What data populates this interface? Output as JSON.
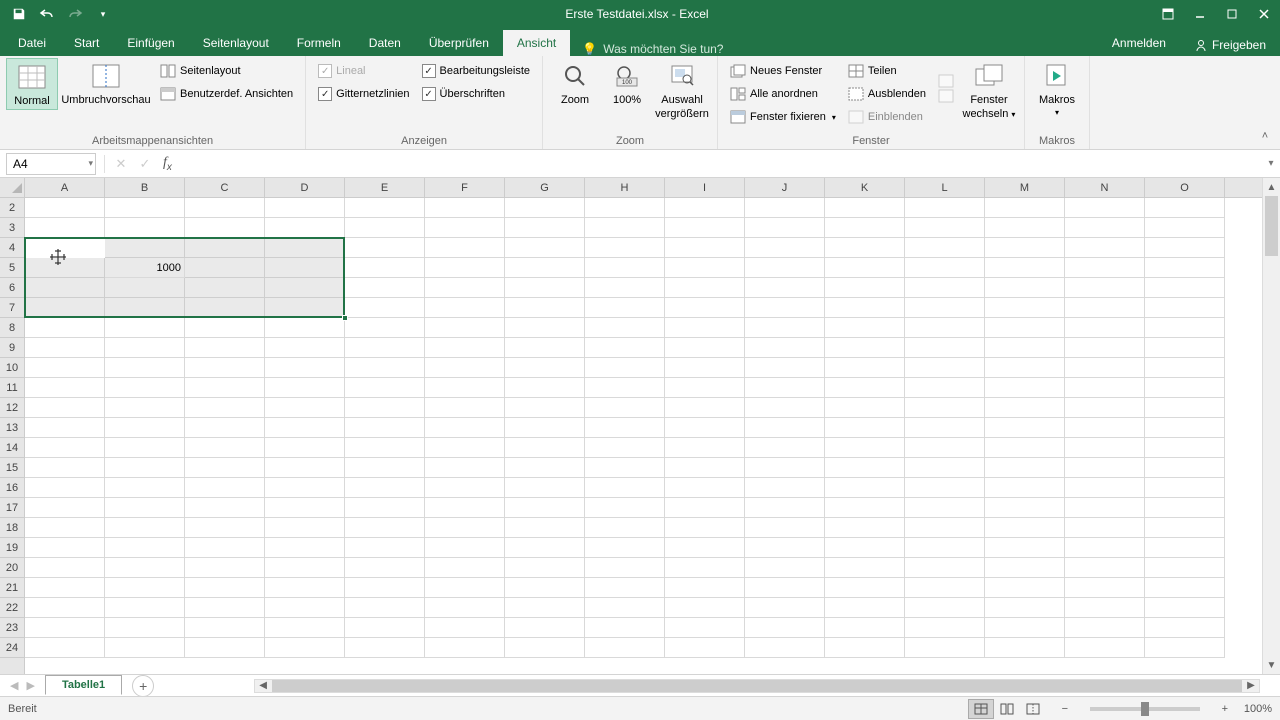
{
  "title": "Erste Testdatei.xlsx - Excel",
  "qat": {
    "save": "💾"
  },
  "tabs": {
    "file": "Datei",
    "home": "Start",
    "insert": "Einfügen",
    "pagelayout": "Seitenlayout",
    "formulas": "Formeln",
    "data": "Daten",
    "review": "Überprüfen",
    "view": "Ansicht"
  },
  "tellme_placeholder": "Was möchten Sie tun?",
  "signin": "Anmelden",
  "share": "Freigeben",
  "ribbon": {
    "views": {
      "normal": "Normal",
      "pagebreak": "Umbruchvorschau",
      "pagelayout": "Seitenlayout",
      "custom": "Benutzerdef. Ansichten",
      "group": "Arbeitsmappenansichten"
    },
    "show": {
      "ruler": "Lineal",
      "formulabar": "Bearbeitungsleiste",
      "gridlines": "Gitternetzlinien",
      "headings": "Überschriften",
      "group": "Anzeigen"
    },
    "zoom": {
      "zoom": "Zoom",
      "hundred": "100%",
      "selection_l1": "Auswahl",
      "selection_l2": "vergrößern",
      "group": "Zoom"
    },
    "window": {
      "new": "Neues Fenster",
      "arrange": "Alle anordnen",
      "freeze": "Fenster fixieren",
      "split": "Teilen",
      "hide": "Ausblenden",
      "unhide": "Einblenden",
      "switch_l1": "Fenster",
      "switch_l2": "wechseln",
      "group": "Fenster"
    },
    "macros": {
      "macros": "Makros",
      "group": "Makros"
    }
  },
  "name_box": "A4",
  "columns": [
    "A",
    "B",
    "C",
    "D",
    "E",
    "F",
    "G",
    "H",
    "I",
    "J",
    "K",
    "L",
    "M",
    "N",
    "O"
  ],
  "rows": [
    2,
    3,
    4,
    5,
    6,
    7,
    8,
    9,
    10,
    11,
    12,
    13,
    14,
    15,
    16,
    17,
    18,
    19,
    20,
    21,
    22,
    23,
    24
  ],
  "cell_B5": "1000",
  "selection": {
    "from": "A4",
    "to": "D7"
  },
  "sheet": "Tabelle1",
  "status": "Bereit",
  "zoom": "100%",
  "chart_data": null
}
